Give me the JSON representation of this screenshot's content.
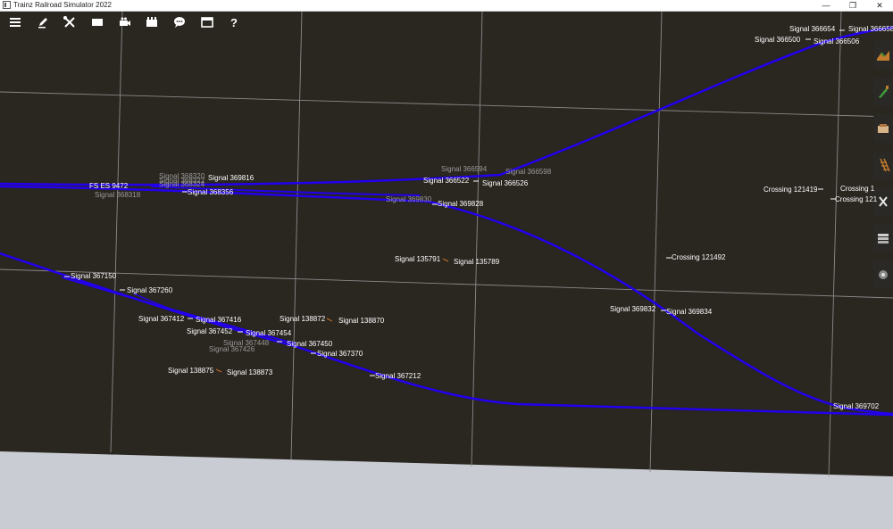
{
  "window": {
    "title": "Trainz Railroad Simulator 2022",
    "minimize_glyph": "—",
    "maximize_glyph": "❐",
    "close_glyph": "✕"
  },
  "toolbar": {
    "icons": [
      "menu-icon",
      "edit-icon",
      "tools-icon",
      "view-icon",
      "camera-icon",
      "library-icon",
      "chat-icon",
      "window-icon",
      "help-icon"
    ],
    "help_glyph": "?"
  },
  "side_tools": [
    "terrain-tool-icon",
    "paint-tool-icon",
    "objects-tool-icon",
    "track-tool-icon",
    "trackside-tool-icon",
    "layers-tool-icon",
    "settings-tool-icon"
  ],
  "colors": {
    "ground": "#2a2620",
    "sky": "#cdd3db",
    "track": "#2200ee",
    "grid": "#8a8a8a",
    "label": "#ffffff",
    "label_dim": "#9a9a9a"
  },
  "labels": [
    {
      "text": "Signal 366654",
      "dim": false
    },
    {
      "text": "Signal 366658",
      "dim": false
    },
    {
      "text": "Signal 366500",
      "dim": false
    },
    {
      "text": "Signal 366506",
      "dim": false
    },
    {
      "text": "Signal 366594",
      "dim": true
    },
    {
      "text": "Signal 366598",
      "dim": true
    },
    {
      "text": "Signal 366522",
      "dim": false
    },
    {
      "text": "Signal 366526",
      "dim": false
    },
    {
      "text": "Signal 369830",
      "dim": true
    },
    {
      "text": "Signal 369828",
      "dim": false
    },
    {
      "text": "Signal 368320",
      "dim": true
    },
    {
      "text": "Signal 368322",
      "dim": true
    },
    {
      "text": "Signal 368324",
      "dim": true
    },
    {
      "text": "Signal 369816",
      "dim": false
    },
    {
      "text": "FS ES 9472",
      "dim": false
    },
    {
      "text": "Signal 368318",
      "dim": true
    },
    {
      "text": "Signal 368356",
      "dim": false
    },
    {
      "text": "Crossing 121419",
      "dim": false
    },
    {
      "text": "Crossing 1",
      "dim": false
    },
    {
      "text": "Crossing 121",
      "dim": false
    },
    {
      "text": "Signal 135791",
      "dim": false
    },
    {
      "text": "Signal 135789",
      "dim": false
    },
    {
      "text": "Crossing 121492",
      "dim": false
    },
    {
      "text": "Signal 367150",
      "dim": false
    },
    {
      "text": "Signal 367260",
      "dim": false
    },
    {
      "text": "Signal 367412",
      "dim": false
    },
    {
      "text": "Signal 367416",
      "dim": false
    },
    {
      "text": "Signal 138872",
      "dim": false
    },
    {
      "text": "Signal 138870",
      "dim": false
    },
    {
      "text": "Signal 367452",
      "dim": false
    },
    {
      "text": "Signal 367454",
      "dim": false
    },
    {
      "text": "Signal 367448",
      "dim": true
    },
    {
      "text": "Signal 367450",
      "dim": false
    },
    {
      "text": "Signal 367426",
      "dim": true
    },
    {
      "text": "Signal 367370",
      "dim": false
    },
    {
      "text": "Signal 138875",
      "dim": false
    },
    {
      "text": "Signal 138873",
      "dim": false
    },
    {
      "text": "Signal 367212",
      "dim": false
    },
    {
      "text": "Signal 369832",
      "dim": false
    },
    {
      "text": "Signal 369834",
      "dim": false
    },
    {
      "text": "Signal 369702",
      "dim": false
    }
  ]
}
